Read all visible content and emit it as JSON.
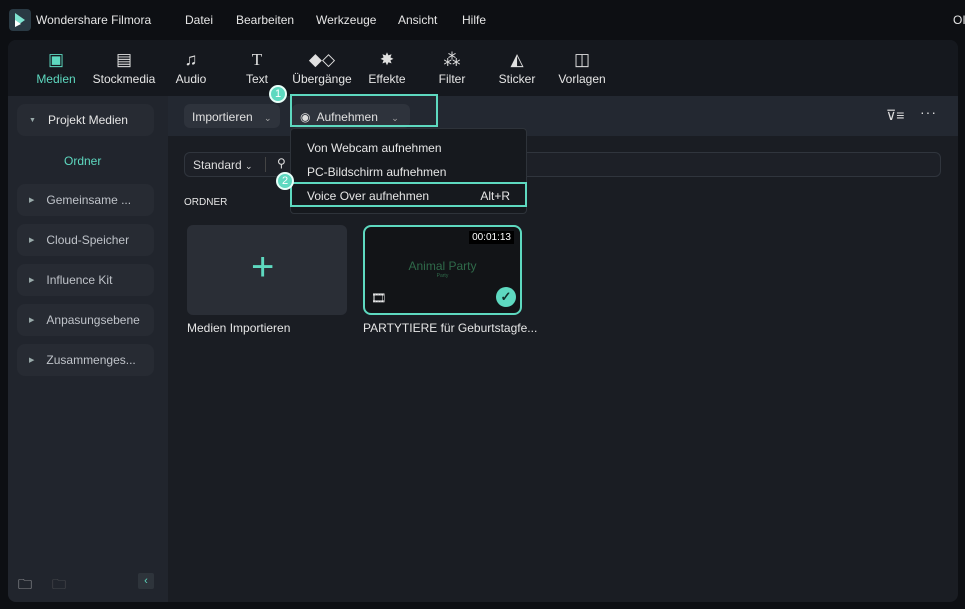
{
  "titlebar": {
    "app_name": "Wondershare Filmora",
    "menu": [
      "Datei",
      "Bearbeiten",
      "Werkzeuge",
      "Ansicht",
      "Hilfe"
    ],
    "right_text": "OI"
  },
  "toolbar": {
    "items": [
      {
        "label": "Medien",
        "icon": "media-icon",
        "active": true
      },
      {
        "label": "Stockmedia",
        "icon": "stock-folder-icon"
      },
      {
        "label": "Audio",
        "icon": "music-note-icon"
      },
      {
        "label": "Text",
        "icon": "text-icon"
      },
      {
        "label": "Übergänge",
        "icon": "transition-icon"
      },
      {
        "label": "Effekte",
        "icon": "sparkle-icon"
      },
      {
        "label": "Filter",
        "icon": "filter-circles-icon"
      },
      {
        "label": "Sticker",
        "icon": "sticker-icon"
      },
      {
        "label": "Vorlagen",
        "icon": "template-icon"
      }
    ]
  },
  "sidebar": {
    "items": [
      {
        "label": "Projekt Medien",
        "expanded": true
      },
      {
        "label": "Ordner",
        "child": true
      },
      {
        "label": "Gemeinsame ..."
      },
      {
        "label": "Cloud-Speicher"
      },
      {
        "label": "Influence Kit"
      },
      {
        "label": "Anpasungsebene"
      },
      {
        "label": "Zusammenges..."
      }
    ]
  },
  "subbar": {
    "import_label": "Importieren",
    "record_label": "Aufnehmen",
    "badge1": "1",
    "badge2": "2"
  },
  "dropdown": {
    "items": [
      {
        "label": "Von Webcam aufnehmen"
      },
      {
        "label": "PC-Bildschirm aufnehmen"
      },
      {
        "label": "Voice Over aufnehmen",
        "shortcut": "Alt+R"
      }
    ]
  },
  "filter": {
    "sort_label": "Standard"
  },
  "section_label": "ORDNER",
  "media": [
    {
      "label": "Medien Importieren"
    },
    {
      "label": "PARTYTIERE für Geburtstagfe...",
      "duration": "00:01:13",
      "thumb_title": "Animal Party",
      "thumb_sub": "Party"
    }
  ],
  "colors": {
    "accent": "#5ed9c0"
  }
}
